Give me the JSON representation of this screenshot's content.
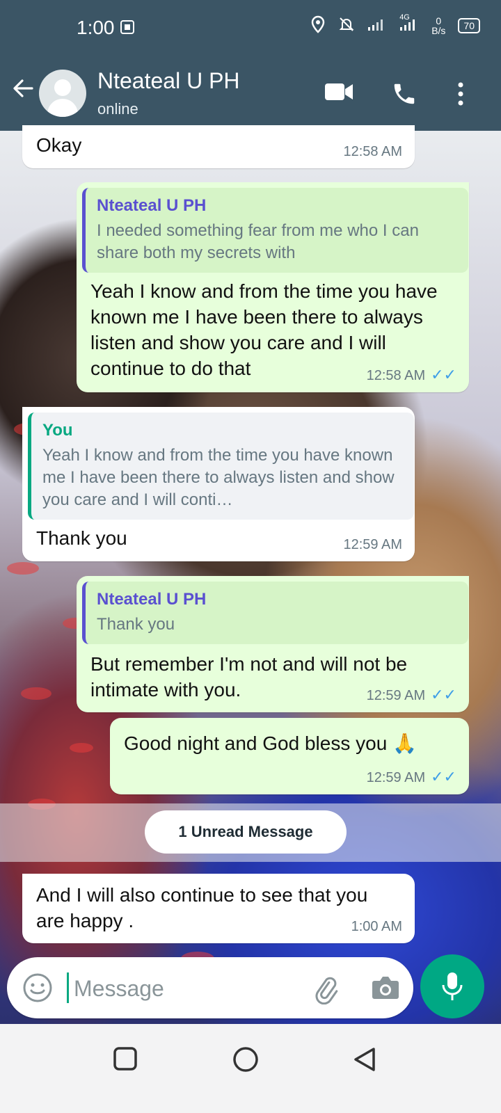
{
  "status_bar": {
    "time": "1:00",
    "net_4g": "4G",
    "data_rate": "0",
    "data_unit": "B/s",
    "battery": "70"
  },
  "header": {
    "name": "Nteateal U PH",
    "status": "online"
  },
  "messages": [
    {
      "text": "Okay",
      "time": "12:58 AM"
    },
    {
      "quote_author": "Nteateal U PH",
      "quote_text": "I needed something fear from me who I can share both my secrets with",
      "text": "Yeah I know and from the time you have known me I have been there to always listen and show you care and I will continue to do that",
      "time": "12:58 AM"
    },
    {
      "quote_author": "You",
      "quote_text": "Yeah I know and from the time you have known me I have been there to always listen and show you care and I will conti…",
      "text": "Thank you",
      "time": "12:59 AM"
    },
    {
      "quote_author": "Nteateal U PH",
      "quote_text": "Thank you",
      "text": "But remember I'm not and will not be intimate with you.",
      "time": "12:59 AM"
    },
    {
      "text": "Good night and God bless you 🙏",
      "time": "12:59 AM"
    },
    {
      "text": "And I will also continue to see  that you are happy .",
      "time": "1:00 AM"
    }
  ],
  "unread_banner": "1 Unread Message",
  "composer": {
    "placeholder": "Message"
  },
  "colors": {
    "header": "#3b5565",
    "outgoing": "#e7ffdb",
    "accent": "#00a884",
    "ticks": "#3e9ee7"
  },
  "icons": [
    "back-arrow-icon",
    "video-call-icon",
    "voice-call-icon",
    "more-vert-icon",
    "emoji-icon",
    "attach-icon",
    "camera-icon",
    "mic-icon",
    "nav-square-icon",
    "nav-circle-icon",
    "nav-back-icon"
  ]
}
